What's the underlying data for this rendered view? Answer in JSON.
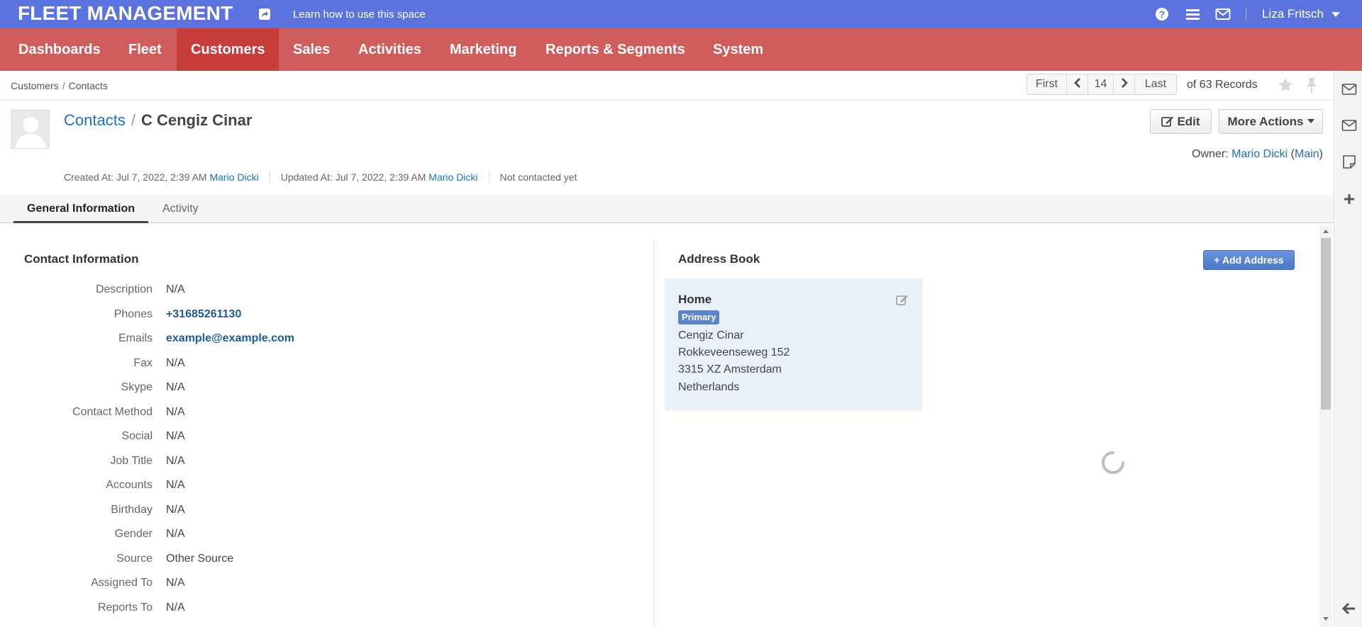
{
  "topbar": {
    "brand": "FLEET MANAGEMENT",
    "learn_link": "Learn how to use this space",
    "user_name": "Liza Fritsch",
    "color": "#5a73df"
  },
  "nav": {
    "color": "#d05c5c",
    "active_color": "#c93c3c",
    "items": [
      {
        "label": "Dashboards"
      },
      {
        "label": "Fleet"
      },
      {
        "label": "Customers"
      },
      {
        "label": "Sales"
      },
      {
        "label": "Activities"
      },
      {
        "label": "Marketing"
      },
      {
        "label": "Reports & Segments"
      },
      {
        "label": "System"
      }
    ],
    "active": "Customers"
  },
  "breadcrumb": [
    "Customers",
    "Contacts"
  ],
  "pager": {
    "first": "First",
    "current": "14",
    "last": "Last",
    "records": "of 63 Records"
  },
  "header": {
    "parent": "Contacts",
    "separator": "/",
    "name": "C Cengiz Cinar",
    "edit_label": "Edit",
    "more_actions_label": "More Actions",
    "owner_label": "Owner:",
    "owner_name": "Mario Dicki",
    "owner_unit": "Main",
    "created_label": "Created At: Jul 7, 2022, 2:39 AM",
    "created_by": "Mario Dicki",
    "updated_label": "Updated At: Jul 7, 2022, 2:39 AM",
    "updated_by": "Mario Dicki",
    "contact_status": "Not contacted yet"
  },
  "tabs": [
    {
      "label": "General Information",
      "active": true
    },
    {
      "label": "Activity",
      "active": false
    }
  ],
  "contact_info": {
    "title": "Contact Information",
    "fields": [
      {
        "label": "Description",
        "value": "N/A"
      },
      {
        "label": "Phones",
        "value": "+31685261130"
      },
      {
        "label": "Emails",
        "value": "example@example.com"
      },
      {
        "label": "Fax",
        "value": "N/A"
      },
      {
        "label": "Skype",
        "value": "N/A"
      },
      {
        "label": "Contact Method",
        "value": "N/A"
      },
      {
        "label": "Social",
        "value": "N/A"
      },
      {
        "label": "Job Title",
        "value": "N/A"
      },
      {
        "label": "Accounts",
        "value": "N/A"
      },
      {
        "label": "Birthday",
        "value": "N/A"
      },
      {
        "label": "Gender",
        "value": "N/A"
      },
      {
        "label": "Source",
        "value": "Other Source"
      },
      {
        "label": "Assigned To",
        "value": "N/A"
      },
      {
        "label": "Reports To",
        "value": "N/A"
      }
    ]
  },
  "address_book": {
    "title": "Address Book",
    "add_label": "+ Add Address",
    "address": {
      "type": "Home",
      "badge": "Primary",
      "lines": [
        "Cengiz Cinar",
        "Rokkeveenseweg 152",
        "3315 XZ Amsterdam",
        "Netherlands"
      ]
    }
  },
  "icons": {
    "share": "share-icon",
    "help": "help-icon",
    "menu": "menu-icon",
    "mail": "mail-icon",
    "star": "star-icon",
    "pin": "pin-icon",
    "edit": "edit-icon",
    "note": "note-icon",
    "plus": "plus-icon",
    "back": "arrow-left-icon"
  }
}
